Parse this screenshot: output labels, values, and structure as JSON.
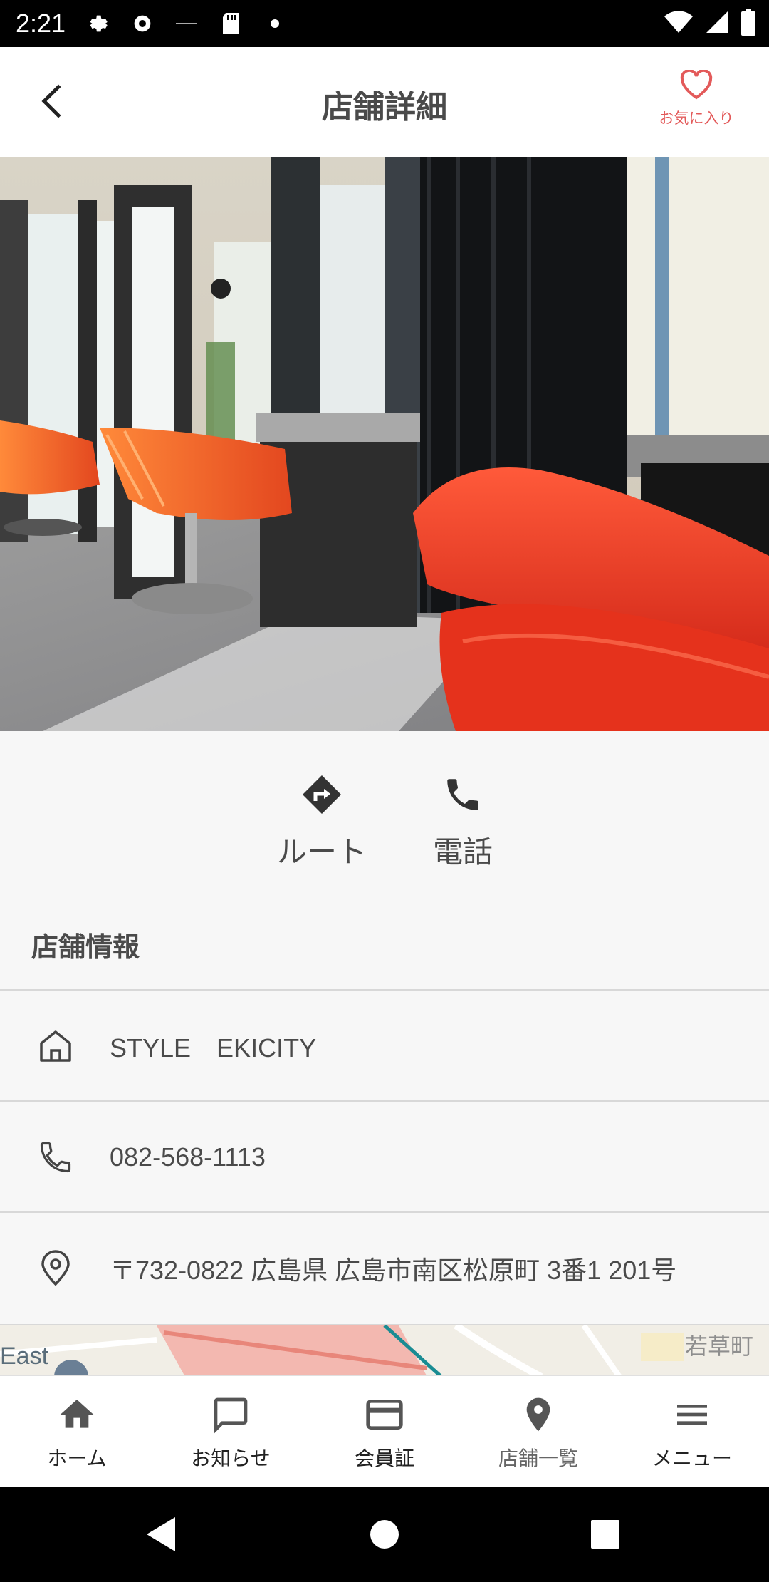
{
  "status_bar": {
    "time": "2:21"
  },
  "header": {
    "title": "店舗詳細",
    "favorite_label": "お気に入り",
    "accent_color": "#e35a5a"
  },
  "actions": [
    {
      "icon": "route-icon",
      "label": "ルート"
    },
    {
      "icon": "phone-icon",
      "label": "電話"
    }
  ],
  "store_info": {
    "section_title": "店舗情報",
    "name": "STYLE　EKICITY",
    "phone": "082-568-1113",
    "address": "〒732-0822 広島県 広島市南区松原町 3番1 201号"
  },
  "map": {
    "label_left": "East",
    "label_right": "若草町"
  },
  "bottom_nav": [
    {
      "icon": "home-icon",
      "label": "ホーム"
    },
    {
      "icon": "chat-icon",
      "label": "お知らせ"
    },
    {
      "icon": "card-icon",
      "label": "会員証"
    },
    {
      "icon": "location-pin-icon",
      "label": "店舗一覧",
      "active": true
    },
    {
      "icon": "menu-icon",
      "label": "メニュー"
    }
  ]
}
